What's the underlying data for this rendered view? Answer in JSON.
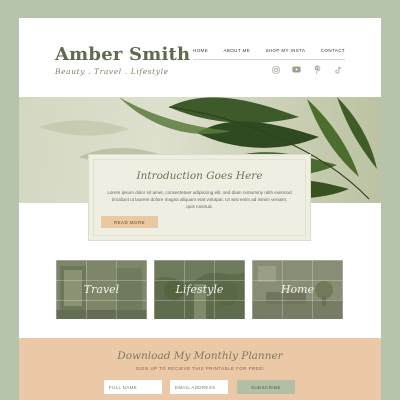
{
  "header": {
    "brand_title": "Amber Smith",
    "brand_tagline": "Beauty . Travel . Lifestyle"
  },
  "nav": {
    "items": [
      {
        "label": "HOME"
      },
      {
        "label": "ABOUT ME"
      },
      {
        "label": "SHOP MY INSTA"
      },
      {
        "label": "CONTACT"
      }
    ]
  },
  "social": {
    "icons": [
      "instagram-icon",
      "youtube-icon",
      "pinterest-icon",
      "tiktok-icon"
    ]
  },
  "intro": {
    "title": "Introduction Goes Here",
    "body": "Lorem ipsum dolor sit amet, consectetuer adipiscing elit, sed diam nonummy nibh euismod tincidunt ut laoreet dolore magna aliquam erat volutpat. Ut wisi enim ad minim veniam, quis nostrud.",
    "button_label": "READ MORE"
  },
  "categories": [
    {
      "label": "Travel"
    },
    {
      "label": "Lifestyle"
    },
    {
      "label": "Home"
    }
  ],
  "planner": {
    "title": "Download My Monthly Planner",
    "subtitle": "SIGN UP TO RECIEVE THIS PRINTABLE FOR FREE!",
    "name_placeholder": "FULL NAME",
    "email_placeholder": "EMAIL ADDRESS",
    "subscribe_label": "SUBSCRIBE"
  },
  "colors": {
    "background": "#b7c4ad",
    "brand": "#5f6a4e",
    "accent_peach": "#ecc9a6",
    "button_sage": "#b4c0a6"
  }
}
